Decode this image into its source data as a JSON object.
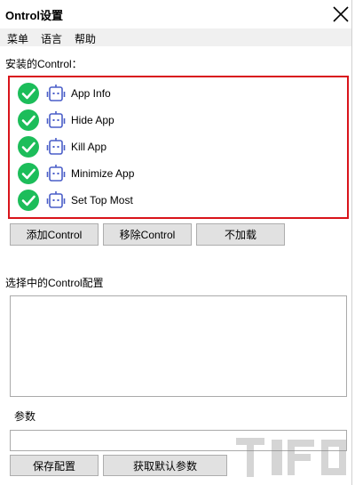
{
  "window": {
    "title": "Ontrol设置"
  },
  "menu": [
    {
      "label": "菜单"
    },
    {
      "label": "语言"
    },
    {
      "label": "帮助"
    }
  ],
  "installed_label": "安装的Control：",
  "controls": [
    {
      "name": "App Info",
      "status": "enabled"
    },
    {
      "name": "Hide App",
      "status": "enabled"
    },
    {
      "name": "Kill App",
      "status": "enabled"
    },
    {
      "name": "Minimize App",
      "status": "enabled"
    },
    {
      "name": "Set Top Most",
      "status": "enabled"
    }
  ],
  "buttons": {
    "add": "添加Control",
    "remove": "移除Control",
    "unload": "不加载",
    "save_config": "保存配置",
    "get_defaults": "获取默认参数"
  },
  "selected_config_label": "选择中的Control配置",
  "params_label": "参数",
  "config_text": "",
  "params_value": "",
  "colors": {
    "check_green": "#1cbd5a",
    "robot_blue": "#4a5ec8",
    "highlight_red": "#d9141b",
    "button_bg": "#e1e1e1"
  },
  "icons": {
    "close": "close-icon",
    "check": "checkmark-circle-icon",
    "control": "robot-icon"
  }
}
